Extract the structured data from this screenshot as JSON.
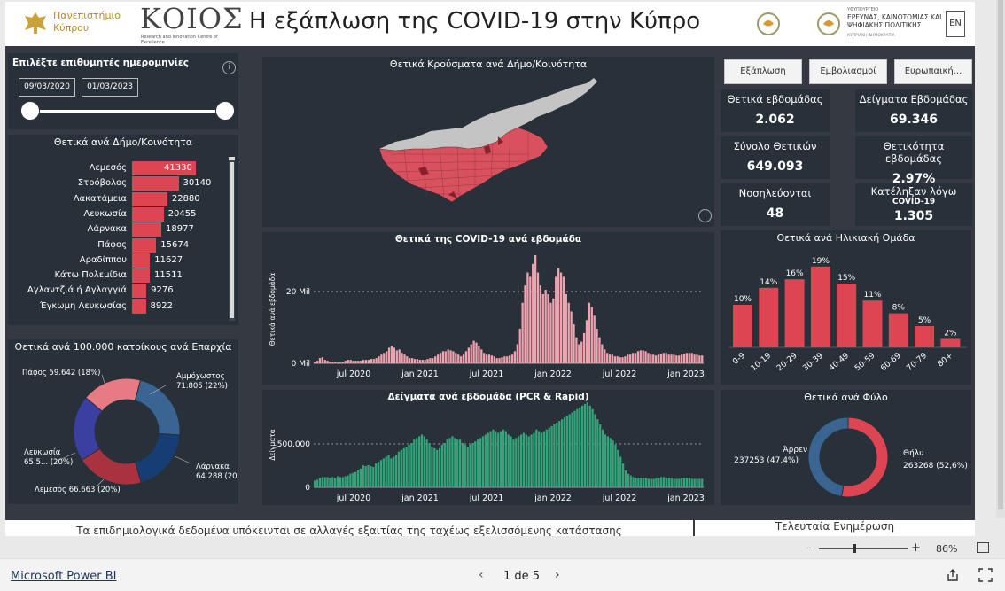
{
  "header": {
    "university_name": "Πανεπιστήμιο Κύπρου",
    "kois_logo_text": "ΚΟΙΟΣ",
    "kois_subtitle": "Research and Innovation Centre of Excellence",
    "title": "Η εξάπλωση της COVID-19 στην Κύπρο",
    "ministry_text_small": "ΥΦΥΠΟΥΡΓΕΙΟ",
    "ministry_text": "ΕΡΕΥΝΑΣ, ΚΑΙΝΟΤΟΜΙΑΣ ΚΑΙ ΨΗΦΙΑΚΗΣ ΠΟΛΙΤΙΚΗΣ",
    "ministry_text_tiny": "ΚΥΠΡΙΑΚΗ ΔΗΜΟΚΡΑΤΙΑ",
    "lang_button": "EN"
  },
  "date_filter": {
    "label": "Επιλέξτε επιθυμητές ημερομηνίες",
    "start": "09/03/2020",
    "end": "01/03/2023",
    "info": "i"
  },
  "tabs": [
    "Εξάπλωση",
    "Εμβολιασμοί",
    "Ευρωπαική..."
  ],
  "municipality_bars": {
    "title": "Θετικά ανά Δήμο/Κοινότητα",
    "max": 41330,
    "items": [
      {
        "name": "Λεμεσός",
        "value": 41330,
        "label": "41330"
      },
      {
        "name": "Στρόβολος",
        "value": 30140,
        "label": "30140"
      },
      {
        "name": "Λακατάμεια",
        "value": 22880,
        "label": "22880"
      },
      {
        "name": "Λευκωσία",
        "value": 20455,
        "label": "20455"
      },
      {
        "name": "Λάρνακα",
        "value": 18977,
        "label": "18977"
      },
      {
        "name": "Πάφος",
        "value": 15674,
        "label": "15674"
      },
      {
        "name": "Αραδίππου",
        "value": 11627,
        "label": "11627"
      },
      {
        "name": "Κάτω Πολεμίδια",
        "value": 11511,
        "label": "11511"
      },
      {
        "name": "Αγλαντζιά ή Αγλαγγιά",
        "value": 9276,
        "label": "9276"
      },
      {
        "name": "Έγκωμη Λευκωσίας",
        "value": 8922,
        "label": "8922"
      }
    ]
  },
  "per100k": {
    "title": "Θετικά ανά 100.000 κατοίκους ανά Επαρχία",
    "slices": [
      {
        "name": "Αμμόχωστος",
        "value": 71805,
        "pct": 22,
        "label_line1": "Αμμόχωστος",
        "label_line2": "71.805 (22%)",
        "color": "#3a6592"
      },
      {
        "name": "Λάρνακα",
        "value": 64288,
        "pct": 20,
        "label_line1": "Λάρνακα",
        "label_line2": "64.288 (20%)",
        "color": "#173e74"
      },
      {
        "name": "Λεμεσός",
        "value": 66663,
        "pct": 20,
        "label_line1": "Λεμεσός 66.663 (20%)",
        "label_line2": "",
        "color": "#a8323e"
      },
      {
        "name": "Λευκωσία",
        "value": 65500,
        "pct": 20,
        "label_line1": "Λευκωσία",
        "label_line2": "65.5... (20%)",
        "color": "#3c3fa2"
      },
      {
        "name": "Πάφος",
        "value": 59642,
        "pct": 18,
        "label_line1": "Πάφος 59.642 (18%)",
        "label_line2": "",
        "color": "#e77a82"
      }
    ]
  },
  "map": {
    "title": "Θετικά Κρούσματα ανά Δήμο/Κοινότητα",
    "info": "i"
  },
  "weekly_cases": {
    "title": "Θετικά της COVID-19 ανά εβδομάδα",
    "ylabel": "Θετικά ανά εβδομάδα",
    "y_ticks": [
      "20 Mil",
      "0 Mil"
    ],
    "x_ticks": [
      "jul 2020",
      "jan 2021",
      "jul 2021",
      "jan 2022",
      "jul 2022",
      "jan 2023"
    ]
  },
  "weekly_tests": {
    "title": "Δείγματα ανά εβδομάδα (PCR & Rapid)",
    "ylabel": "Δείγματα",
    "y_ticks": [
      "500.000",
      "0"
    ],
    "x_ticks": [
      "jul 2020",
      "jan 2021",
      "jul 2021",
      "jan 2022",
      "jul 2022",
      "jan 2023"
    ]
  },
  "kpis": [
    {
      "label": "Θετικά εβδομάδας",
      "value": "2.062",
      "sub": ""
    },
    {
      "label": "Δείγματα Εβδομάδας",
      "value": "69.346",
      "sub": ""
    },
    {
      "label": "Σύνολο Θετικών",
      "value": "649.093",
      "sub": ""
    },
    {
      "label": "Θετικότητα εβδομάδας",
      "value": "2,97%",
      "sub": ""
    },
    {
      "label": "Νοσηλεύονται",
      "value": "48",
      "sub": ""
    },
    {
      "label": "Κατέληξαν λόγω",
      "value": "1.305",
      "sub": "COVID-19"
    }
  ],
  "age_chart": {
    "title": "Θετικά ανά Ηλικιακή Ομάδα",
    "groups": [
      "0-9",
      "10-19",
      "20-29",
      "30-39",
      "40-49",
      "50-59",
      "60-69",
      "70-79",
      "80+"
    ],
    "values": [
      10,
      14,
      16,
      19,
      15,
      11,
      8,
      5,
      2
    ],
    "labels": [
      "10%",
      "14%",
      "16%",
      "19%",
      "15%",
      "11%",
      "8%",
      "5%",
      "2%"
    ]
  },
  "gender_chart": {
    "title": "Θετικά ανά Φύλο",
    "slices": [
      {
        "name": "Άρρεν",
        "value": 237253,
        "pct": 47.4,
        "label": "237253 (47,4%)",
        "color": "#3a6592"
      },
      {
        "name": "Θήλυ",
        "value": 263268,
        "pct": 52.6,
        "label": "263268 (52,6%)",
        "color": "#de4553"
      }
    ]
  },
  "footer": {
    "disclaimer": "Τα επιδημιολογικά δεδομένα υπόκεινται σε αλλαγές εξαιτίας της ταχέως εξελισσόμενης κατάστασης",
    "last_update": "Τελευταία Ενημέρωση"
  },
  "zoom": {
    "minus": "-",
    "plus": "+",
    "level": "86%"
  },
  "bottom_bar": {
    "brand": "Microsoft Power BI",
    "page": "1 de 5"
  },
  "colors": {
    "bg": "#353a42",
    "card": "#283039",
    "accent": "#de4553",
    "cases": "#f0a3ae",
    "tests": "#34a57a",
    "header_gold": "#c9a23a"
  },
  "series": {
    "cases": [
      2,
      3,
      6,
      7,
      4,
      3,
      2,
      2,
      2,
      1,
      1,
      2,
      3,
      4,
      4,
      3,
      3,
      3,
      3,
      4,
      4,
      4,
      5,
      5,
      6,
      8,
      10,
      12,
      14,
      18,
      20,
      18,
      15,
      16,
      12,
      10,
      8,
      6,
      6,
      5,
      5,
      4,
      4,
      4,
      5,
      6,
      6,
      8,
      10,
      12,
      14,
      14,
      16,
      15,
      14,
      12,
      10,
      8,
      10,
      14,
      18,
      22,
      26,
      24,
      20,
      16,
      12,
      10,
      10,
      9,
      8,
      6,
      6,
      7,
      8,
      8,
      9,
      10,
      14,
      22,
      40,
      70,
      90,
      105,
      100,
      115,
      125,
      105,
      90,
      80,
      85,
      80,
      70,
      75,
      100,
      110,
      105,
      100,
      80,
      70,
      60,
      45,
      30,
      22,
      25,
      35,
      50,
      70,
      65,
      55,
      40,
      30,
      22,
      16,
      12,
      10,
      10,
      8,
      8,
      7,
      7,
      8,
      10,
      10,
      12,
      12,
      14,
      15,
      15,
      14,
      12,
      10,
      10,
      9,
      10,
      11,
      12,
      12,
      10,
      10,
      10,
      9,
      9,
      10,
      11,
      12,
      12,
      12,
      10,
      10,
      9,
      9
    ],
    "tests": [
      8,
      9,
      11,
      12,
      12,
      12,
      11,
      12,
      11,
      13,
      12,
      12,
      13,
      14,
      16,
      17,
      18,
      20,
      22,
      26,
      25,
      26,
      25,
      24,
      28,
      30,
      32,
      34,
      36,
      38,
      34,
      36,
      38,
      42,
      44,
      46,
      48,
      50,
      52,
      56,
      58,
      60,
      62,
      60,
      56,
      52,
      48,
      46,
      44,
      46,
      50,
      52,
      56,
      58,
      60,
      58,
      56,
      56,
      52,
      50,
      48,
      50,
      52,
      54,
      56,
      58,
      60,
      62,
      64,
      66,
      68,
      66,
      64,
      66,
      68,
      66,
      62,
      60,
      56,
      58,
      60,
      62,
      64,
      62,
      60,
      62,
      64,
      68,
      66,
      64,
      66,
      68,
      70,
      72,
      74,
      76,
      78,
      80,
      82,
      84,
      86,
      88,
      90,
      92,
      94,
      96,
      98,
      100,
      96,
      92,
      86,
      80,
      74,
      68,
      62,
      60,
      58,
      55,
      50,
      44,
      36,
      28,
      20,
      16,
      14,
      12,
      11,
      11,
      11,
      11,
      11,
      10,
      10,
      10,
      11,
      11,
      12,
      12,
      11,
      11,
      11,
      10,
      10,
      10,
      11,
      11,
      11,
      11,
      10,
      10,
      10,
      10,
      10
    ]
  }
}
